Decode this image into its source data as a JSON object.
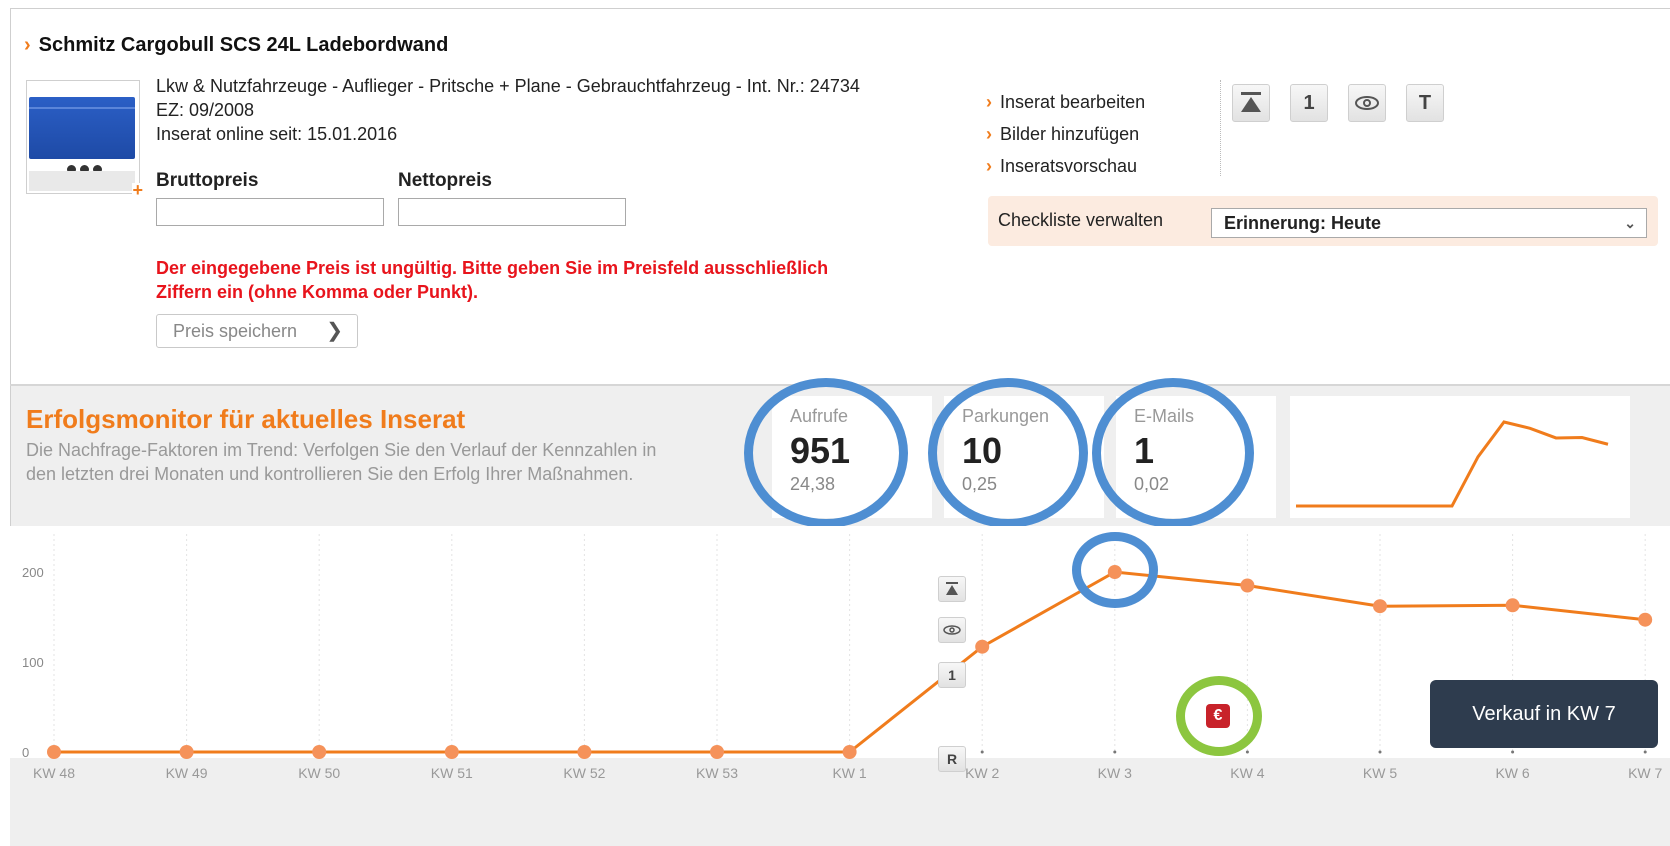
{
  "listing": {
    "title": "Schmitz Cargobull SCS 24L Ladebordwand",
    "details": "Lkw & Nutzfahrzeuge - Auflieger - Pritsche + Plane - Gebrauchtfahrzeug - Int. Nr.: 24734",
    "ez": "EZ: 09/2008",
    "online_since": "Inserat online seit: 15.01.2016",
    "gross_label": "Bruttopreis",
    "net_label": "Nettopreis",
    "gross_value": "",
    "net_value": "",
    "error_line1": "Der eingegebene Preis ist ungültig. Bitte geben Sie im Preisfeld ausschließlich",
    "error_line2": "Ziffern ein (ohne Komma oder Punkt).",
    "save_label": "Preis speichern"
  },
  "actions": {
    "links": [
      "Inserat bearbeiten",
      "Bilder hinzufügen",
      "Inseratsvorschau"
    ],
    "icon_buttons": [
      "push-up-icon",
      "1",
      "eye-icon",
      "T"
    ],
    "checklist_label": "Checkliste verwalten",
    "reminder_value": "Erinnerung: Heute"
  },
  "monitor": {
    "title": "Erfolgsmonitor für aktuelles Inserat",
    "subtitle_line1": "Die Nachfrage-Faktoren im Trend: Verfolgen Sie den Verlauf der Kennzahlen in",
    "subtitle_line2": "den letzten drei Monaten und kontrollieren Sie den Erfolg Ihrer Maßnahmen.",
    "kpis": [
      {
        "label": "Aufrufe",
        "value": "951",
        "sub": "24,38"
      },
      {
        "label": "Parkungen",
        "value": "10",
        "sub": "0,25"
      },
      {
        "label": "E-Mails",
        "value": "1",
        "sub": "0,02"
      }
    ],
    "tooltip": "Verkauf in KW 7",
    "markers": [
      "push-up-icon",
      "eye-icon",
      "1",
      "R"
    ],
    "sale_icon": "€"
  },
  "colors": {
    "accent": "#f07c1c",
    "error": "#e8141c",
    "highlight_ring": "#4e8ed2",
    "sale_ring": "#8cc63f",
    "tooltip_bg": "#2e3c4e"
  },
  "chart_data": {
    "type": "line",
    "categories": [
      "KW 48",
      "KW 49",
      "KW 50",
      "KW 51",
      "KW 52",
      "KW 53",
      "KW 1",
      "KW 2",
      "KW 3",
      "KW 4",
      "KW 5",
      "KW 6",
      "KW 7"
    ],
    "values": [
      0,
      0,
      0,
      0,
      0,
      0,
      0,
      117,
      200,
      185,
      162,
      163,
      147
    ],
    "yticks": [
      "200",
      "100",
      "0"
    ],
    "ylim": [
      0,
      200
    ],
    "grid": true
  },
  "sparkline": {
    "type": "line",
    "values": [
      0,
      0,
      0,
      0,
      0,
      0,
      0,
      117,
      200,
      185,
      162,
      163,
      147
    ]
  }
}
